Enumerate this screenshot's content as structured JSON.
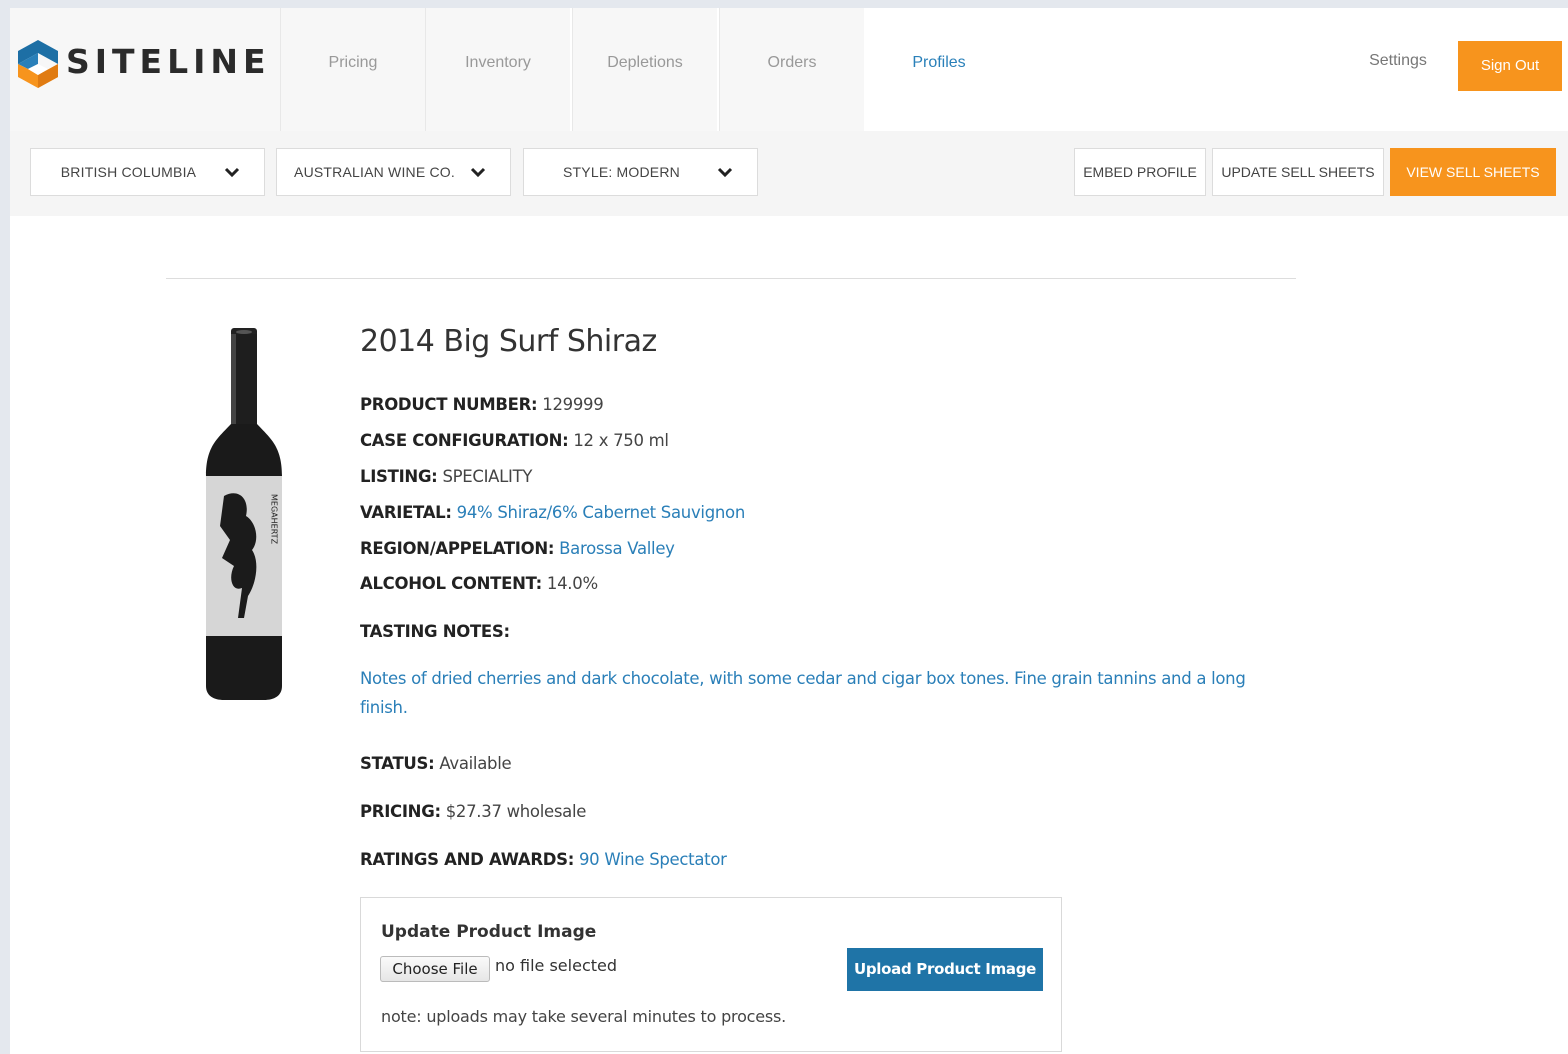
{
  "app": {
    "brand": "SITELINE"
  },
  "nav": {
    "tabs": [
      {
        "label": "Pricing",
        "active": false
      },
      {
        "label": "Inventory",
        "active": false
      },
      {
        "label": "Depletions",
        "active": false
      },
      {
        "label": "Orders",
        "active": false
      },
      {
        "label": "Profiles",
        "active": true
      }
    ],
    "settings": "Settings",
    "signout": "Sign Out"
  },
  "filters": {
    "region": "BRITISH COLUMBIA",
    "supplier": "AUSTRALIAN WINE CO.",
    "style": "STYLE: MODERN"
  },
  "actions": {
    "embed": "EMBED PROFILE",
    "update": "UPDATE SELL SHEETS",
    "view": "VIEW SELL SHEETS"
  },
  "product": {
    "title": "2014 Big Surf Shiraz",
    "bottle_label": "MEGAHERTZ",
    "fields": {
      "product_number": {
        "label": "PRODUCT NUMBER:",
        "value": "129999"
      },
      "case_config": {
        "label": "CASE CONFIGURATION:",
        "value": "12 x 750 ml"
      },
      "listing": {
        "label": "LISTING:",
        "value": "SPECIALITY"
      },
      "varietal": {
        "label": "VARIETAL:",
        "value": "94% Shiraz/6% Cabernet Sauvignon"
      },
      "region": {
        "label": "REGION/APPELATION:",
        "value": "Barossa Valley"
      },
      "alcohol": {
        "label": "ALCOHOL CONTENT:",
        "value": "14.0%"
      },
      "tasting_label": "TASTING NOTES:",
      "tasting_notes": "Notes of dried cherries and dark chocolate, with some cedar and cigar box tones. Fine grain tannins and a long finish.",
      "status": {
        "label": "STATUS:",
        "value": "Available"
      },
      "pricing": {
        "label": "PRICING:",
        "value": "$27.37 wholesale"
      },
      "ratings": {
        "label": "RATINGS AND AWARDS:",
        "value": "90 Wine Spectator"
      }
    }
  },
  "upload": {
    "title": "Update Product Image",
    "choose": "Choose File",
    "nofile": "no file selected",
    "button": "Upload Product Image",
    "note": "note: uploads may take several minutes to process."
  },
  "colors": {
    "accent": "#f7941d",
    "link": "#2a7fb8",
    "upload_button": "#1f74a7"
  },
  "icons": {
    "dropdown": "chevron-down-icon",
    "logo": "siteline-logo-icon"
  }
}
